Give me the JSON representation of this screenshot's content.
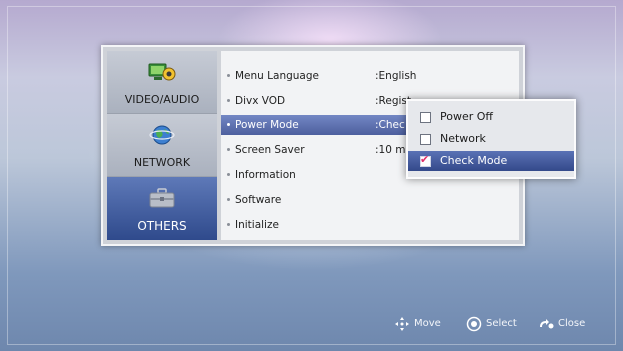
{
  "categories": [
    {
      "label": "VIDEO/AUDIO",
      "icon": "video-audio-icon",
      "active": false
    },
    {
      "label": "NETWORK",
      "icon": "network-globe-icon",
      "active": false
    },
    {
      "label": "OTHERS",
      "icon": "toolbox-icon",
      "active": true
    }
  ],
  "items": [
    {
      "name": "Menu Language",
      "value": ":English"
    },
    {
      "name": "Divx VOD",
      "value": ":Regist"
    },
    {
      "name": "Power Mode",
      "value": ":Chec"
    },
    {
      "name": "Screen Saver",
      "value": ":10 mi"
    },
    {
      "name": "Information",
      "value": ""
    },
    {
      "name": "Software",
      "value": ""
    },
    {
      "name": "Initialize",
      "value": ""
    }
  ],
  "selected_item": "Power Mode",
  "popup": {
    "options": [
      {
        "label": "Power Off",
        "checked": false
      },
      {
        "label": "Network",
        "checked": false
      },
      {
        "label": "Check Mode",
        "checked": true
      }
    ]
  },
  "footer": {
    "move": "Move",
    "select": "Select",
    "close": "Close"
  },
  "colors": {
    "accent": "#4d5f9e",
    "active_category": "#2f4a8c",
    "check_mark": "#e0306a"
  }
}
